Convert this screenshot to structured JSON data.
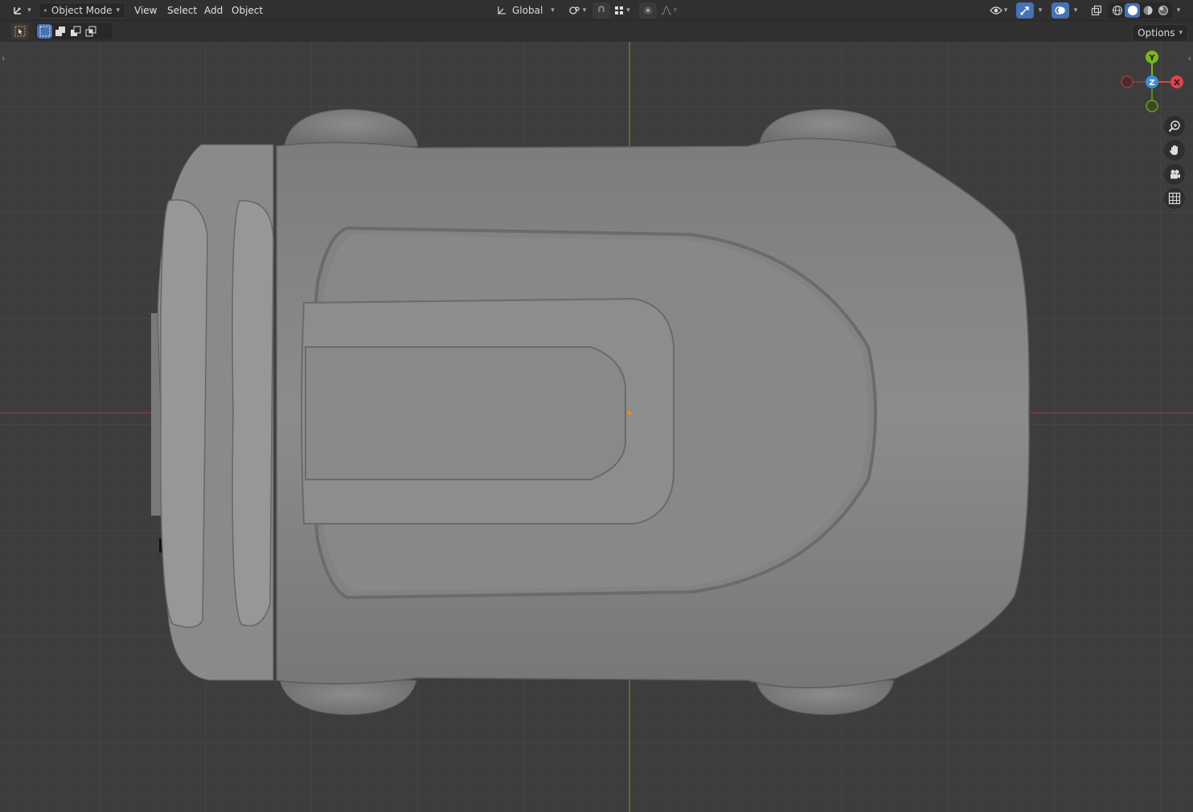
{
  "header": {
    "editor_type_icon": "object-mode-axes-icon",
    "mode_selector": "Object Mode",
    "menus": [
      "View",
      "Select",
      "Add",
      "Object"
    ],
    "transform_orientation": "Global",
    "pivot_icon": "pivot-point-icon",
    "snap_icon": "magnet-snap-icon",
    "snap_increment_icon": "snap-increment-icon",
    "proportional_icon": "proportional-editing-icon",
    "falloff_icon": "falloff-curve-icon",
    "visibility_icon": "eye-visibility-icon",
    "gizmo_icon": "gizmo-toggle-icon",
    "overlay_icon": "overlays-icon",
    "xray_icon": "xray-icon",
    "shading_modes": [
      "wireframe",
      "solid",
      "material-preview",
      "rendered"
    ],
    "active_shading": "solid"
  },
  "tool_settings": {
    "tool_icon": "select-box-icon",
    "selection_modes": [
      "set-new",
      "extend",
      "subtract",
      "intersect"
    ],
    "options_label": "Options"
  },
  "navigation_gizmo": {
    "axes": {
      "x": "X",
      "y": "Y",
      "z": "Z"
    },
    "colors": {
      "x": "#e0424b",
      "y": "#7cb51c",
      "z": "#3b8fd6"
    }
  },
  "viewport_tools": [
    "zoom-icon",
    "pan-hand-icon",
    "camera-icon",
    "ortho-grid-icon"
  ],
  "theme": {
    "grid_bg": "#3d3d3d",
    "x_axis_color": "#9a3b40",
    "y_axis_color": "#6e9a2a",
    "active_button": "#4772b3",
    "origin_color": "#f08a24"
  }
}
